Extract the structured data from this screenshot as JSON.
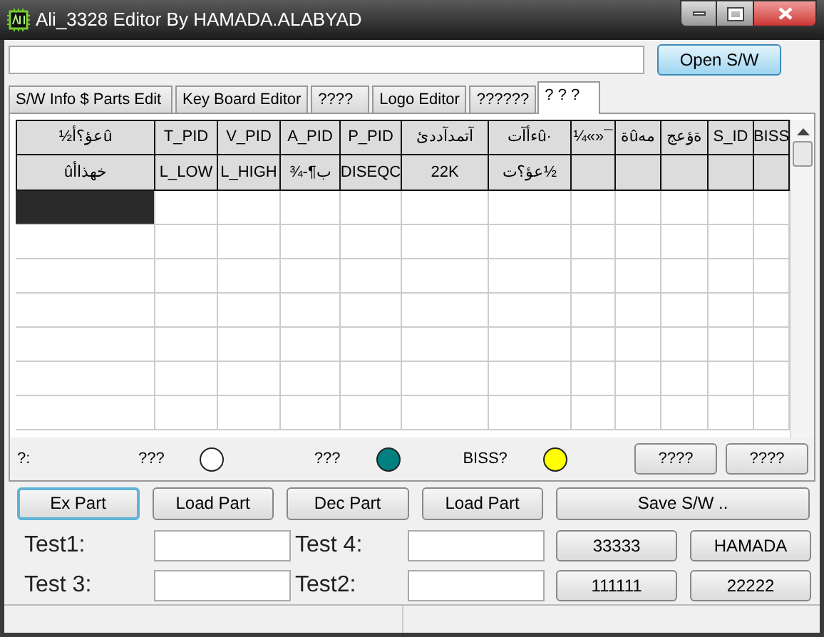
{
  "window": {
    "title": "Ali_3328 Editor By HAMADA.ALABYAD"
  },
  "open_button": "Open S/W",
  "tabs": [
    {
      "label": "S/W Info $ Parts Edit",
      "selected": false
    },
    {
      "label": "Key Board Editor",
      "selected": false
    },
    {
      "label": "????",
      "selected": false
    },
    {
      "label": "Logo Editor",
      "selected": false
    },
    {
      "label": "??????",
      "selected": false
    },
    {
      "label": "? ? ?",
      "selected": true
    }
  ],
  "table": {
    "header_rows": [
      {
        "cells": [
          "½عؤ؟أû",
          "T_PID",
          "V_PID",
          "A_PID",
          "P_PID",
          "آتمدآددئ",
          "ءأآتû·",
          "¼«»¯",
          "ةûمه",
          "ةؤعج",
          "S_ID",
          "BISS"
        ]
      },
      {
        "cells": [
          "ûخهذاأ",
          "L_LOW",
          "L_HIGH",
          "¾-¶ب",
          "DISEQC",
          "22K",
          "عؤ؟ت½"
        ]
      }
    ],
    "blank_rows": [
      {
        "selected": true
      },
      {
        "selected": false
      },
      {
        "selected": false
      },
      {
        "selected": false
      },
      {
        "selected": false
      },
      {
        "selected": false
      },
      {
        "selected": false
      }
    ]
  },
  "indicators_label": "?:",
  "indicators": [
    {
      "label": "???",
      "color": "#ffffff"
    },
    {
      "label": "???",
      "color": "#008080"
    },
    {
      "label": "BISS?",
      "color": "#ffff00"
    }
  ],
  "small_buttons": [
    "????",
    "????"
  ],
  "action_buttons": [
    {
      "label": "Ex Part",
      "focused": true
    },
    {
      "label": "Load Part",
      "focused": false
    },
    {
      "label": "Dec Part",
      "focused": false
    },
    {
      "label": "Load Part",
      "focused": false
    },
    {
      "label": "Save S/W ..",
      "focused": false
    }
  ],
  "tests": [
    {
      "label": "Test1:"
    },
    {
      "label": "Test 4:"
    },
    {
      "label": "Test 3:"
    },
    {
      "label": "Test2:"
    }
  ],
  "number_buttons": [
    "33333",
    "HAMADA",
    "111111",
    "22222"
  ]
}
